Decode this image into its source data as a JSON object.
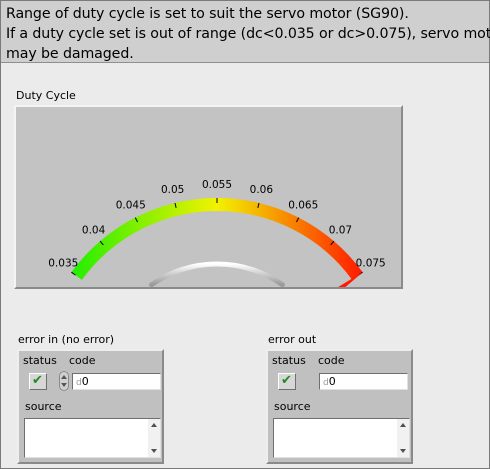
{
  "header": {
    "line1": "Range of duty cycle is set to suit the servo motor (SG90).",
    "line2": "If a duty cycle set is out of range (dc<0.035 or dc>0.075), servo motor",
    "line3": "may be damaged."
  },
  "gauge": {
    "label": "Duty Cycle",
    "min": 0.035,
    "max": 0.075,
    "value": 0.075,
    "ticks": [
      "0.035",
      "0.04",
      "0.045",
      "0.05",
      "0.055",
      "0.06",
      "0.065",
      "0.07",
      "0.075"
    ],
    "colors": {
      "low": "#22ee00",
      "mid": "#f2f200",
      "high": "#ff1a00",
      "needle": "#ff1a00"
    }
  },
  "error_in": {
    "title": "error in (no error)",
    "status_label": "status",
    "code_label": "code",
    "code_prefix": "d",
    "code_value": "0",
    "source_label": "source",
    "status_icon": "checkmark-icon"
  },
  "error_out": {
    "title": "error out",
    "status_label": "status",
    "code_label": "code",
    "code_prefix": "d",
    "code_value": "0",
    "source_label": "source",
    "status_icon": "checkmark-icon"
  }
}
